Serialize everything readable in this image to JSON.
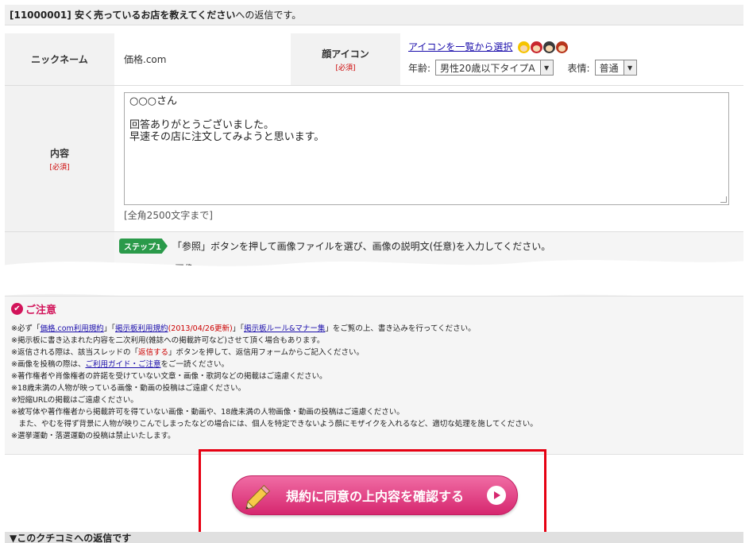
{
  "header": {
    "prefix": "[11000001] 安く売っているお店を教えてください",
    "suffix": "への返信です。"
  },
  "form": {
    "nickname_label": "ニックネーム",
    "nickname_value": "価格.com",
    "icon_label": "顔アイコン",
    "required": "[必須]",
    "icon_link": "アイコンを一覧から選択",
    "age_label": "年齢:",
    "age_value": "男性20歳以下タイプA",
    "expression_label": "表情:",
    "expression_value": "普通",
    "content_label": "内容",
    "content_text": "○○○さん\n\n回答ありがとうございました。\n早速その店に注文してみようと思います。",
    "char_limit": "[全角2500文字まで]",
    "step_badge": "ステップ1",
    "step_text": "「参照」ボタンを押して画像ファイルを選び、画像の説明文(任意)を入力してください。",
    "image_label": "画像："
  },
  "notice": {
    "title": "ご注意",
    "line1_a": "※必ず「",
    "line1_link1": "価格.com利用規約",
    "line1_b": "」「",
    "line1_link2": "掲示板利用規約",
    "line1_red": "(2013/04/26更新)",
    "line1_c": "」「",
    "line1_link3": "掲示板ルール&マナー集",
    "line1_d": "」をご覧の上、書き込みを行ってください。",
    "line2": "※掲示板に書き込まれた内容を二次利用(雑誌への掲載許可など)させて頂く場合もあります。",
    "line3_a": "※返信される際は、該当スレッドの「",
    "line3_red": "返信する",
    "line3_b": "」ボタンを押して、返信用フォームからご記入ください。",
    "line4_a": "※画像を投稿の際は、",
    "line4_link": "ご利用ガイド・ご注意",
    "line4_b": "をご一読ください。",
    "line5": "※著作権者や肖像権者の許諾を受けていない文章・画像・歌詞などの掲載はご遠慮ください。",
    "line6": "※18歳未満の人物が映っている画像・動画の投稿はご遠慮ください。",
    "line7": "※短縮URLの掲載はご遠慮ください。",
    "line8": "※被写体や著作権者から掲載許可を得ていない画像・動画や、18歳未満の人物画像・動画の投稿はご遠慮ください。",
    "line9": "　また、やむを得ず背景に人物が映りこんでしまったなどの場合には、個人を特定できないよう顔にモザイクを入れるなど、適切な処理を施してください。",
    "line10": "※選挙運動・落選運動の投稿は禁止いたします。"
  },
  "confirm_button": "規約に同意の上内容を確認する",
  "bottom_bar": "▼このクチコミへの返信です",
  "colors": {
    "accent_pink": "#d6276f",
    "highlight_red": "#e60012",
    "step_green": "#2a9a4a",
    "link_blue": "#1a0dab"
  },
  "icons": [
    "face-icon-boy-yellow",
    "face-icon-girl-red",
    "face-icon-man",
    "face-icon-woman",
    "check-circle-icon",
    "pencil-icon",
    "play-circle-icon",
    "select-arrow-icon"
  ]
}
